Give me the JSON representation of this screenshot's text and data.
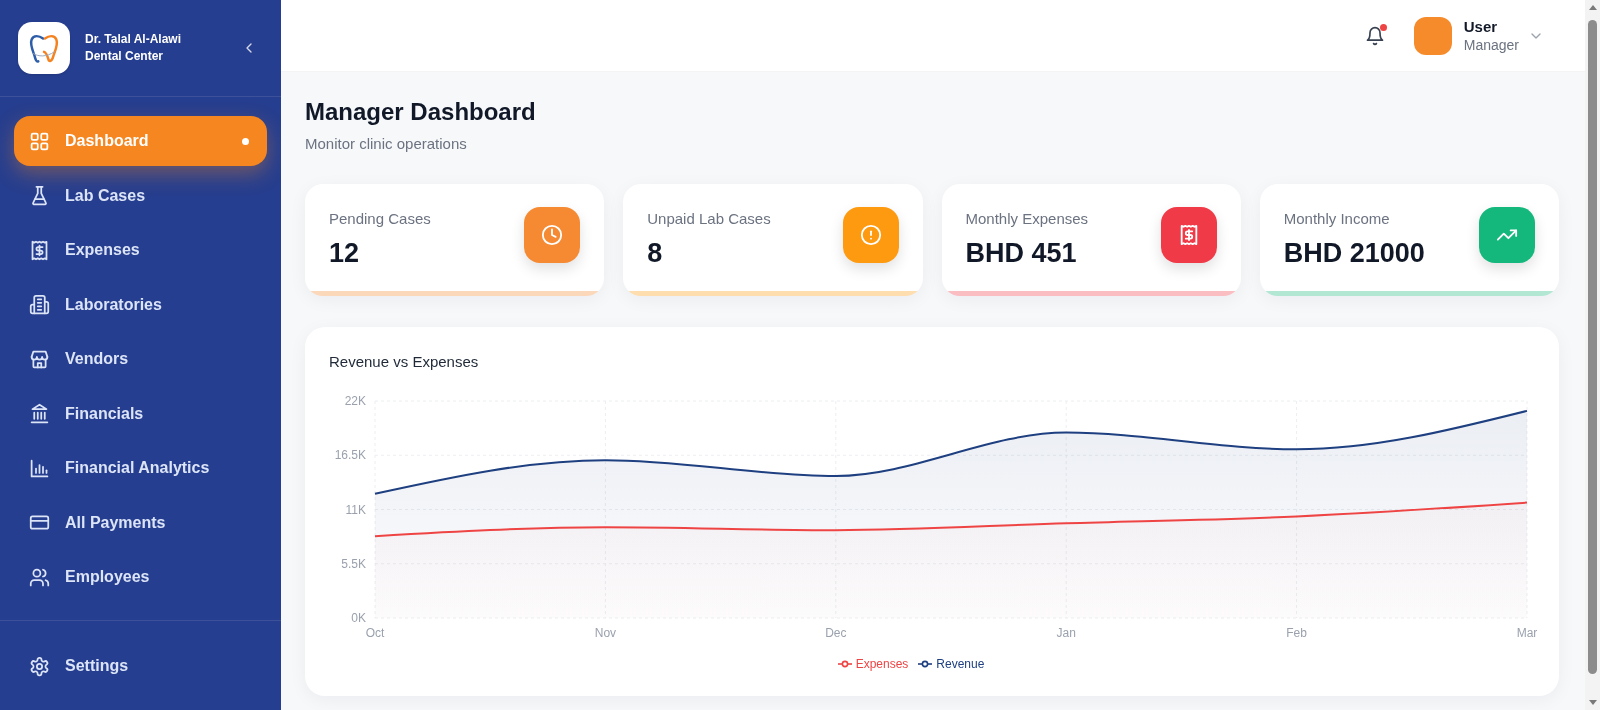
{
  "sidebar": {
    "brand_name": "Dr. Talal Al-Alawi",
    "brand_subtitle": "Dental Center",
    "items": [
      {
        "label": "Dashboard",
        "selected": true
      },
      {
        "label": "Lab Cases",
        "selected": false
      },
      {
        "label": "Expenses",
        "selected": false
      },
      {
        "label": "Laboratories",
        "selected": false
      },
      {
        "label": "Vendors",
        "selected": false
      },
      {
        "label": "Financials",
        "selected": false
      },
      {
        "label": "Financial Analytics",
        "selected": false
      },
      {
        "label": "All Payments",
        "selected": false
      },
      {
        "label": "Employees",
        "selected": false
      }
    ],
    "bottom_items": [
      {
        "label": "Settings",
        "selected": false
      }
    ]
  },
  "header": {
    "notifications": {
      "unread": true
    },
    "user": {
      "name": "User",
      "role": "Manager"
    }
  },
  "page": {
    "title": "Manager Dashboard",
    "subtitle": "Monitor clinic operations"
  },
  "stats": [
    {
      "label": "Pending Cases",
      "value": "12",
      "color": "#f58a32"
    },
    {
      "label": "Unpaid Lab Cases",
      "value": "8",
      "color": "#fd9a10"
    },
    {
      "label": "Monthly Expenses",
      "value": "BHD 451",
      "color": "#f03a47"
    },
    {
      "label": "Monthly Income",
      "value": "BHD 21000",
      "color": "#14b87c"
    }
  ],
  "revenue_chart": {
    "chart_data": {
      "type": "area",
      "title": "Revenue vs Expenses",
      "categories": [
        "Oct",
        "Nov",
        "Dec",
        "Jan",
        "Feb",
        "Mar"
      ],
      "series": [
        {
          "name": "Expenses",
          "color": "#ef4444",
          "values": [
            8300,
            9200,
            8900,
            9600,
            10300,
            11700
          ]
        },
        {
          "name": "Revenue",
          "color": "#1e3f80",
          "values": [
            12600,
            16000,
            14400,
            18800,
            17100,
            21000
          ]
        }
      ],
      "ylim": [
        0,
        22000
      ],
      "yticks": [
        {
          "value": 0,
          "label": "0K"
        },
        {
          "value": 5500,
          "label": "5.5K"
        },
        {
          "value": 11000,
          "label": "11K"
        },
        {
          "value": 16500,
          "label": "16.5K"
        },
        {
          "value": 22000,
          "label": "22K"
        }
      ],
      "grid": true,
      "legend": "bottom"
    }
  }
}
